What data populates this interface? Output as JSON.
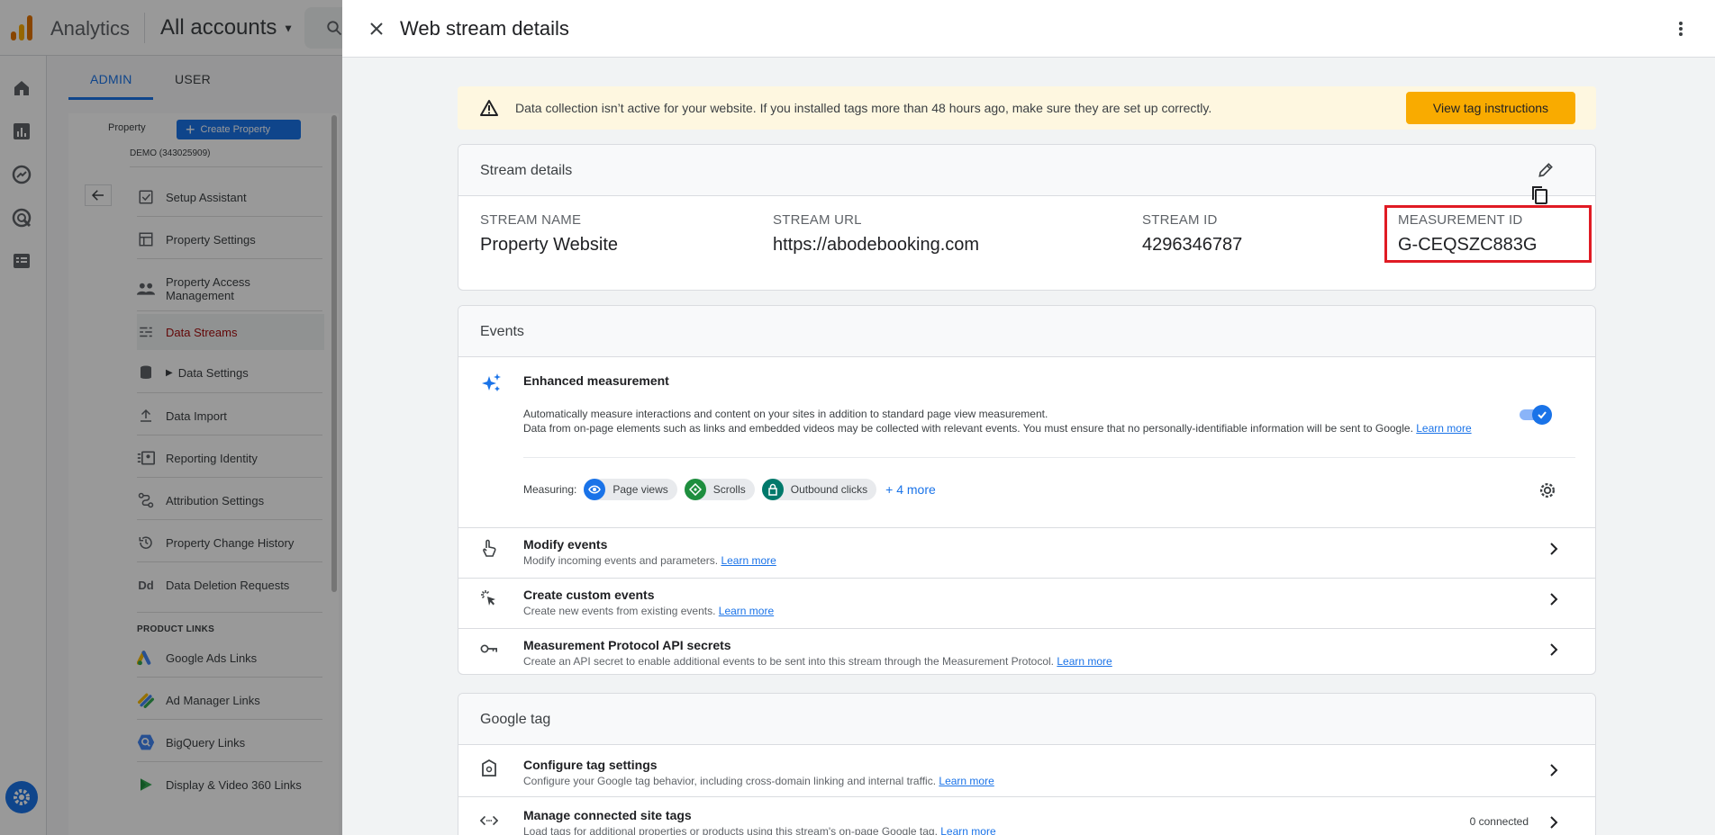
{
  "app": {
    "name": "Analytics",
    "account": "All accounts"
  },
  "admin": {
    "tabs": [
      "ADMIN",
      "USER"
    ],
    "property_label": "Property",
    "create_property": "Create Property",
    "property_name": "DEMO (343025909)",
    "nav": [
      {
        "label": "Setup Assistant",
        "icon": "checklist-icon"
      },
      {
        "label": "Property Settings",
        "icon": "page-icon"
      },
      {
        "label": "Property Access Management",
        "icon": "people-icon"
      },
      {
        "label": "Data Streams",
        "icon": "streams-icon"
      },
      {
        "label": "Data Settings",
        "icon": "database-icon"
      },
      {
        "label": "Data Import",
        "icon": "upload-icon"
      },
      {
        "label": "Reporting Identity",
        "icon": "identity-icon"
      },
      {
        "label": "Attribution Settings",
        "icon": "attribution-icon"
      },
      {
        "label": "Property Change History",
        "icon": "history-icon"
      },
      {
        "label": "Data Deletion Requests",
        "icon": "dd-icon"
      }
    ],
    "product_links_title": "PRODUCT LINKS",
    "product_links": [
      {
        "label": "Google Ads Links",
        "icon": "google-ads-icon"
      },
      {
        "label": "Ad Manager Links",
        "icon": "ad-manager-icon"
      },
      {
        "label": "BigQuery Links",
        "icon": "bigquery-icon"
      },
      {
        "label": "Display & Video 360 Links",
        "icon": "dv360-icon"
      }
    ]
  },
  "drawer": {
    "title": "Web stream details",
    "banner": {
      "message": "Data collection isn’t active for your website. If you installed tags more than 48 hours ago, make sure they are set up correctly.",
      "button": "View tag instructions"
    },
    "stream_details": {
      "title": "Stream details",
      "stream_name_label": "STREAM NAME",
      "stream_name": "Property Website",
      "stream_url_label": "STREAM URL",
      "stream_url": "https://abodebooking.com",
      "stream_id_label": "STREAM ID",
      "stream_id": "4296346787",
      "measurement_id_label": "MEASUREMENT ID",
      "measurement_id": "G-CEQSZC883G"
    },
    "events": {
      "title": "Events",
      "enhanced": {
        "title": "Enhanced measurement",
        "desc1": "Automatically measure interactions and content on your sites in addition to standard page view measurement.",
        "desc2": "Data from on-page elements such as links and embedded videos may be collected with relevant events. You must ensure that no personally-identifiable information will be sent to Google.",
        "learn_more": "Learn more",
        "enabled": true,
        "measuring_label": "Measuring:",
        "chips": [
          "Page views",
          "Scrolls",
          "Outbound clicks"
        ],
        "more": "+ 4 more"
      },
      "rows": [
        {
          "title": "Modify events",
          "sub": "Modify incoming events and parameters.",
          "link": "Learn more"
        },
        {
          "title": "Create custom events",
          "sub": "Create new events from existing events.",
          "link": "Learn more"
        },
        {
          "title": "Measurement Protocol API secrets",
          "sub": "Create an API secret to enable additional events to be sent into this stream through the Measurement Protocol.",
          "link": "Learn more"
        }
      ]
    },
    "google_tag": {
      "title": "Google tag",
      "rows": [
        {
          "title": "Configure tag settings",
          "sub": "Configure your Google tag behavior, including cross-domain linking and internal traffic.",
          "link": "Learn more"
        },
        {
          "title": "Manage connected site tags",
          "sub": "Load tags for additional properties or products using this stream's on-page Google tag.",
          "link": "Learn more",
          "count": "0 connected"
        }
      ]
    }
  },
  "colors": {
    "accent": "#1a73e8",
    "warning_bg": "#fef7e0",
    "warning_button": "#f9ab00",
    "highlight_box": "#e01b24"
  }
}
